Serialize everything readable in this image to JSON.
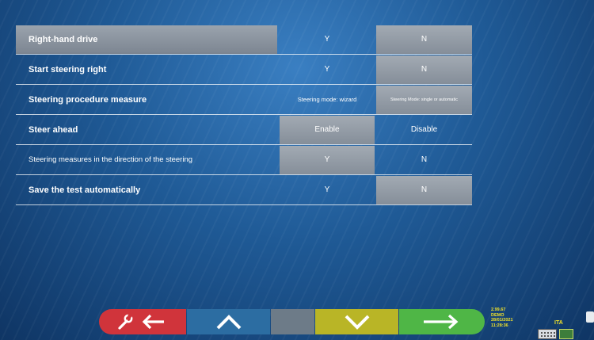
{
  "settings": [
    {
      "label": "Right-hand drive",
      "option_a": "Y",
      "option_b": "N",
      "selected": "b"
    },
    {
      "label": "Start steering right",
      "option_a": "Y",
      "option_b": "N",
      "selected": "b"
    },
    {
      "label": "Steering procedure measure",
      "option_a": "Steering mode: wizard",
      "option_b": "Steering Mode: single or automatic",
      "selected": "b"
    },
    {
      "label": "Steer ahead",
      "option_a": "Enable",
      "option_b": "Disable",
      "selected": "a"
    },
    {
      "label": "Steering measures in the direction of the steering",
      "option_a": "Y",
      "option_b": "N",
      "selected": "a"
    },
    {
      "label": "Save the test automatically",
      "option_a": "Y",
      "option_b": "N",
      "selected": "b"
    }
  ],
  "highlighted_row": 0,
  "navbar": {
    "back_icon": "wrench-back-arrow-icon",
    "up_icon": "chevron-up-icon",
    "down_icon": "chevron-down-icon",
    "next_icon": "arrow-right-icon"
  },
  "status": {
    "version": "2.99.67",
    "mode": "DEMO",
    "date": "28/01/2021",
    "time": "11:28:36",
    "language": "ITA"
  },
  "colors": {
    "back": "#d0343b",
    "up": "#2c6da2",
    "blank": "#6d7b88",
    "down": "#b9b526",
    "next": "#4fb646",
    "status_text": "#f0e12a"
  }
}
